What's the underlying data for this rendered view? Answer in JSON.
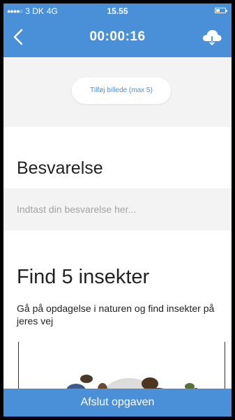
{
  "status_bar": {
    "signal": "●●●●○",
    "carrier": "3 DK",
    "network": "4G",
    "time": "15.55"
  },
  "nav": {
    "timer": "00:00:16"
  },
  "photo": {
    "add_label": "Tilføj billede (max 5)"
  },
  "answer": {
    "heading": "Besvarelse",
    "placeholder": "Indtast din besvarelse her..."
  },
  "task": {
    "title": "Find 5 insekter",
    "description": "Gå på opdagelse i naturen og find insekter på jeres vej"
  },
  "footer": {
    "finish_label": "Afslut opgaven"
  },
  "colors": {
    "accent": "#4a90d9",
    "section_bg": "#f3f3f3"
  }
}
